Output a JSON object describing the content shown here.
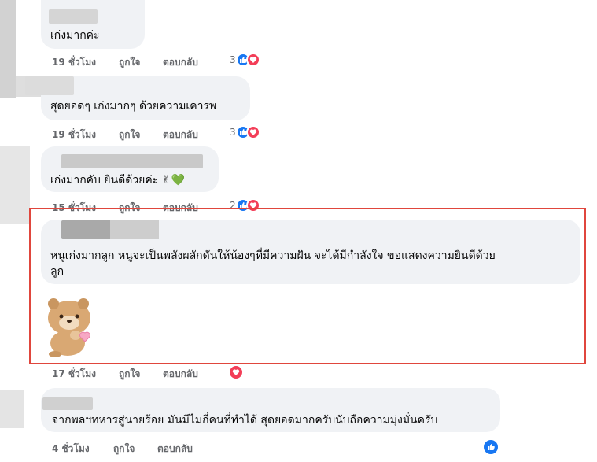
{
  "comments": [
    {
      "text": "เก่งมากค่ะ",
      "time": "19 ชั่วโมง",
      "like": "ถูกใจ",
      "reply": "ตอบกลับ",
      "count": "3"
    },
    {
      "text": "สุดยอดๆ เก่งมากๆ ด้วยความเคารพ",
      "time": "19 ชั่วโมง",
      "like": "ถูกใจ",
      "reply": "ตอบกลับ",
      "count": "3"
    },
    {
      "text": "เก่งมากคับ ยินดีด้วยค่ะ ✌💚",
      "time": "15 ชั่วโมง",
      "like": "ถูกใจ",
      "reply": "ตอบกลับ",
      "count": "2"
    },
    {
      "text_line1": "หนูเก่งมากลูก หนูจะเป็นพลังผลักดันให้น้องๆที่มีความฝัน จะได้มีกำลังใจ ขอแสดงความยินดีด้วย",
      "text_line2": "ลูก",
      "sticker": "bear-heart-sticker",
      "time": "17 ชั่วโมง",
      "like": "ถูกใจ",
      "reply": "ตอบกลับ"
    },
    {
      "text": "จากพลฯทหารสู่นายร้อย มันมีไม่กี่คนที่ทำได้ สุดยอดมากครับนับถือความมุ่งมั่นครับ",
      "time": "4 ชั่วโมง",
      "like": "ถูกใจ",
      "reply": "ตอบกลับ"
    }
  ],
  "colors": {
    "like": "#1877f2",
    "love": "#f33e58",
    "highlight": "#e0463d",
    "bubble": "#f0f2f5"
  }
}
